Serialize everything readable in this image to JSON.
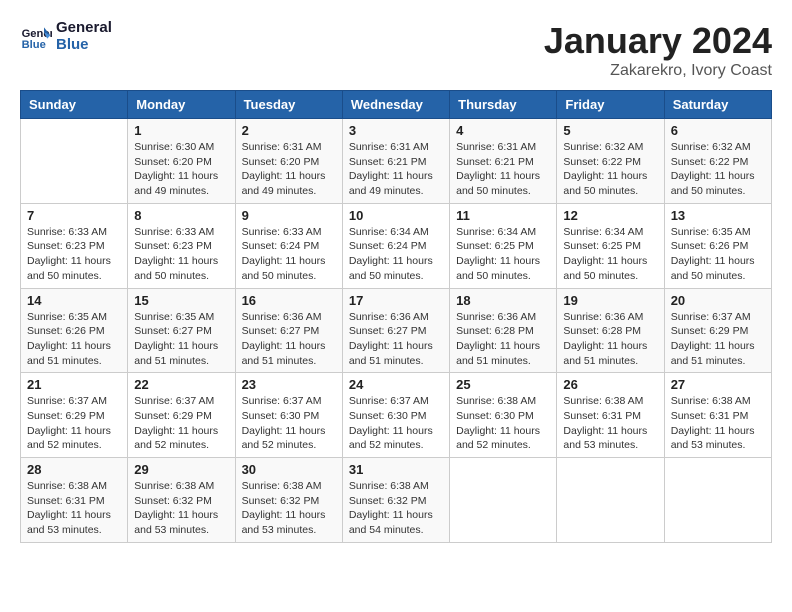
{
  "logo": {
    "line1": "General",
    "line2": "Blue"
  },
  "title": "January 2024",
  "subtitle": "Zakarekro, Ivory Coast",
  "header": {
    "days": [
      "Sunday",
      "Monday",
      "Tuesday",
      "Wednesday",
      "Thursday",
      "Friday",
      "Saturday"
    ]
  },
  "weeks": [
    {
      "cells": [
        {
          "empty": true
        },
        {
          "day": "1",
          "sunrise": "6:30 AM",
          "sunset": "6:20 PM",
          "daylight": "11 hours and 49 minutes."
        },
        {
          "day": "2",
          "sunrise": "6:31 AM",
          "sunset": "6:20 PM",
          "daylight": "11 hours and 49 minutes."
        },
        {
          "day": "3",
          "sunrise": "6:31 AM",
          "sunset": "6:21 PM",
          "daylight": "11 hours and 49 minutes."
        },
        {
          "day": "4",
          "sunrise": "6:31 AM",
          "sunset": "6:21 PM",
          "daylight": "11 hours and 50 minutes."
        },
        {
          "day": "5",
          "sunrise": "6:32 AM",
          "sunset": "6:22 PM",
          "daylight": "11 hours and 50 minutes."
        },
        {
          "day": "6",
          "sunrise": "6:32 AM",
          "sunset": "6:22 PM",
          "daylight": "11 hours and 50 minutes."
        }
      ]
    },
    {
      "cells": [
        {
          "day": "7",
          "sunrise": "6:33 AM",
          "sunset": "6:23 PM",
          "daylight": "11 hours and 50 minutes."
        },
        {
          "day": "8",
          "sunrise": "6:33 AM",
          "sunset": "6:23 PM",
          "daylight": "11 hours and 50 minutes."
        },
        {
          "day": "9",
          "sunrise": "6:33 AM",
          "sunset": "6:24 PM",
          "daylight": "11 hours and 50 minutes."
        },
        {
          "day": "10",
          "sunrise": "6:34 AM",
          "sunset": "6:24 PM",
          "daylight": "11 hours and 50 minutes."
        },
        {
          "day": "11",
          "sunrise": "6:34 AM",
          "sunset": "6:25 PM",
          "daylight": "11 hours and 50 minutes."
        },
        {
          "day": "12",
          "sunrise": "6:34 AM",
          "sunset": "6:25 PM",
          "daylight": "11 hours and 50 minutes."
        },
        {
          "day": "13",
          "sunrise": "6:35 AM",
          "sunset": "6:26 PM",
          "daylight": "11 hours and 50 minutes."
        }
      ]
    },
    {
      "cells": [
        {
          "day": "14",
          "sunrise": "6:35 AM",
          "sunset": "6:26 PM",
          "daylight": "11 hours and 51 minutes."
        },
        {
          "day": "15",
          "sunrise": "6:35 AM",
          "sunset": "6:27 PM",
          "daylight": "11 hours and 51 minutes."
        },
        {
          "day": "16",
          "sunrise": "6:36 AM",
          "sunset": "6:27 PM",
          "daylight": "11 hours and 51 minutes."
        },
        {
          "day": "17",
          "sunrise": "6:36 AM",
          "sunset": "6:27 PM",
          "daylight": "11 hours and 51 minutes."
        },
        {
          "day": "18",
          "sunrise": "6:36 AM",
          "sunset": "6:28 PM",
          "daylight": "11 hours and 51 minutes."
        },
        {
          "day": "19",
          "sunrise": "6:36 AM",
          "sunset": "6:28 PM",
          "daylight": "11 hours and 51 minutes."
        },
        {
          "day": "20",
          "sunrise": "6:37 AM",
          "sunset": "6:29 PM",
          "daylight": "11 hours and 51 minutes."
        }
      ]
    },
    {
      "cells": [
        {
          "day": "21",
          "sunrise": "6:37 AM",
          "sunset": "6:29 PM",
          "daylight": "11 hours and 52 minutes."
        },
        {
          "day": "22",
          "sunrise": "6:37 AM",
          "sunset": "6:29 PM",
          "daylight": "11 hours and 52 minutes."
        },
        {
          "day": "23",
          "sunrise": "6:37 AM",
          "sunset": "6:30 PM",
          "daylight": "11 hours and 52 minutes."
        },
        {
          "day": "24",
          "sunrise": "6:37 AM",
          "sunset": "6:30 PM",
          "daylight": "11 hours and 52 minutes."
        },
        {
          "day": "25",
          "sunrise": "6:38 AM",
          "sunset": "6:30 PM",
          "daylight": "11 hours and 52 minutes."
        },
        {
          "day": "26",
          "sunrise": "6:38 AM",
          "sunset": "6:31 PM",
          "daylight": "11 hours and 53 minutes."
        },
        {
          "day": "27",
          "sunrise": "6:38 AM",
          "sunset": "6:31 PM",
          "daylight": "11 hours and 53 minutes."
        }
      ]
    },
    {
      "cells": [
        {
          "day": "28",
          "sunrise": "6:38 AM",
          "sunset": "6:31 PM",
          "daylight": "11 hours and 53 minutes."
        },
        {
          "day": "29",
          "sunrise": "6:38 AM",
          "sunset": "6:32 PM",
          "daylight": "11 hours and 53 minutes."
        },
        {
          "day": "30",
          "sunrise": "6:38 AM",
          "sunset": "6:32 PM",
          "daylight": "11 hours and 53 minutes."
        },
        {
          "day": "31",
          "sunrise": "6:38 AM",
          "sunset": "6:32 PM",
          "daylight": "11 hours and 54 minutes."
        },
        {
          "empty": true
        },
        {
          "empty": true
        },
        {
          "empty": true
        }
      ]
    }
  ]
}
